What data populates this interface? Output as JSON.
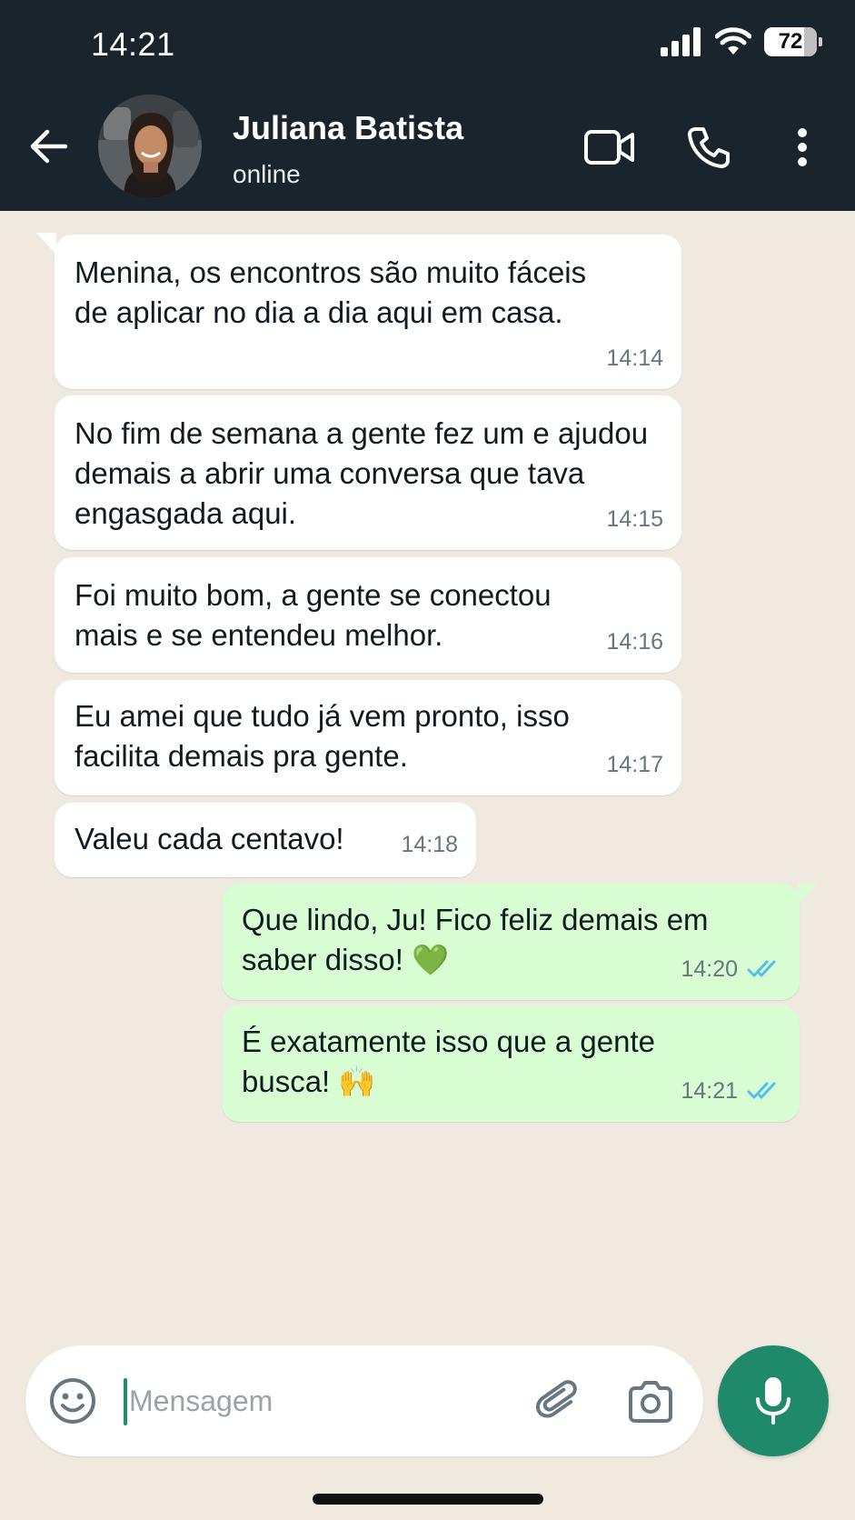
{
  "status_bar": {
    "time": "14:21",
    "battery": "72"
  },
  "header": {
    "contact_name": "Juliana Batista",
    "contact_status": "online",
    "icons": [
      "back-arrow-icon",
      "video-call-icon",
      "phone-icon",
      "more-vertical-icon"
    ]
  },
  "messages": [
    {
      "direction": "incoming",
      "text": "Menina, os encontros são muito fáceis de aplicar no dia a dia aqui em casa.",
      "time": "14:14"
    },
    {
      "direction": "incoming",
      "text": "No fim de semana a gente fez um e ajudou demais a abrir uma conversa que tava engasgada aqui.",
      "time": "14:15"
    },
    {
      "direction": "incoming",
      "text": "Foi muito bom, a gente se conectou mais e se entendeu melhor.",
      "time": "14:16"
    },
    {
      "direction": "incoming",
      "text": "Eu amei que tudo já vem pronto, isso facilita demais pra gente.",
      "time": "14:17"
    },
    {
      "direction": "incoming",
      "text": "Valeu cada centavo!",
      "time": "14:18"
    },
    {
      "direction": "outgoing",
      "text": "Que lindo, Ju! Fico feliz demais em saber disso! 💚",
      "time": "14:20",
      "status": "read"
    },
    {
      "direction": "outgoing",
      "text": "É exatamente isso que a gente busca! 🙌",
      "time": "14:21",
      "status": "read"
    }
  ],
  "composer": {
    "placeholder": "Mensagem",
    "value": ""
  },
  "colors": {
    "header_bg": "#1a242d",
    "chat_bg": "#efe9e0",
    "incoming_bubble": "#ffffff",
    "outgoing_bubble": "#d9fdd3",
    "read_ticks": "#53bdeb",
    "mic_button": "#1f8a6a"
  }
}
